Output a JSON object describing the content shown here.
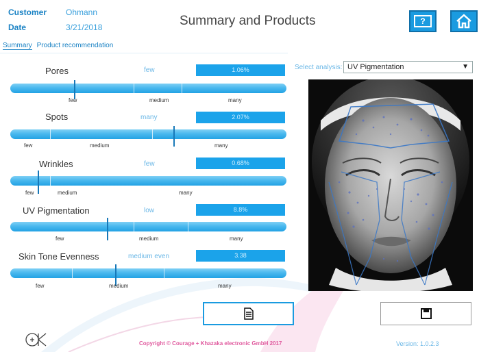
{
  "header": {
    "customer_label": "Customer",
    "customer_value": "Ohmann",
    "date_label": "Date",
    "date_value": "3/21/2018",
    "title": "Summary and Products",
    "help_icon_text": "?"
  },
  "tabs": [
    {
      "label": "Summary",
      "active": true
    },
    {
      "label": "Product recommendation",
      "active": false
    }
  ],
  "metrics": [
    {
      "name": "Pores",
      "level": "few",
      "value": "1.06%",
      "marker_fraction": 0.23,
      "scale": [
        "few",
        "medium",
        "many"
      ]
    },
    {
      "name": "Spots",
      "level": "many",
      "value": "2.07%",
      "marker_fraction": 0.59,
      "scale": [
        "few",
        "medium",
        "many"
      ]
    },
    {
      "name": "Wrinkles",
      "level": "few",
      "value": "0.68%",
      "marker_fraction": 0.1,
      "scale": [
        "few",
        "medium",
        "many"
      ]
    },
    {
      "name": "UV Pigmentation",
      "level": "low",
      "value": "8.8%",
      "marker_fraction": 0.35,
      "scale": [
        "few",
        "medium",
        "many"
      ]
    },
    {
      "name": "Skin Tone Evenness",
      "level": "medium even",
      "value": "3.38",
      "marker_fraction": 0.38,
      "scale": [
        "few",
        "medium",
        "many"
      ]
    }
  ],
  "analysis": {
    "select_label": "Select analysis:",
    "selected": "UV Pigmentation"
  },
  "footer": {
    "copyright": "Copyright © Courage + Khazaka electronic GmbH 2017",
    "version": "Version: 1.0.2.3",
    "logo_text": "CK"
  },
  "colors": {
    "accent": "#1a9be0",
    "bar": "#23a2e4",
    "pink": "#e05a9e"
  },
  "icons": [
    "help-icon",
    "home-icon",
    "document-icon",
    "save-icon",
    "dropdown-arrow-icon"
  ]
}
